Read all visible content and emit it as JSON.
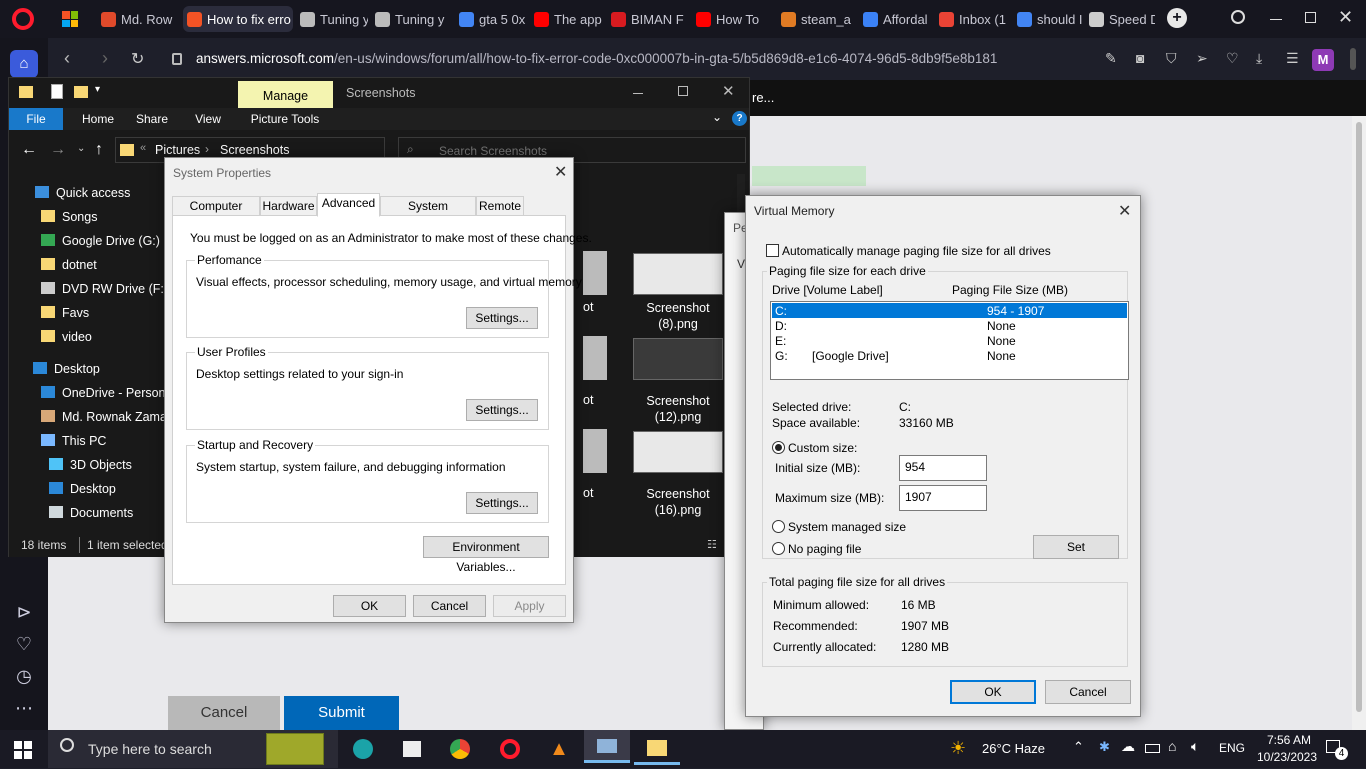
{
  "browser": {
    "tabs": [
      {
        "label": "Md. Row",
        "color": "#e04a2b"
      },
      {
        "label": "How to fix erro",
        "color": "#f35325"
      },
      {
        "label": "Tuning y",
        "color": "#bbbbbb"
      },
      {
        "label": "Tuning y",
        "color": "#bbbbbb"
      },
      {
        "label": "gta 5 0x",
        "color": "#4285f4"
      },
      {
        "label": "The app",
        "color": "#ff0000"
      },
      {
        "label": "BIMAN F",
        "color": "#d81b20"
      },
      {
        "label": "How To",
        "color": "#ff0000"
      },
      {
        "label": "steam_a",
        "color": "#e07b24"
      },
      {
        "label": "Affordal",
        "color": "#3b82f6"
      },
      {
        "label": "Inbox (1",
        "color": "#ea4335"
      },
      {
        "label": "should I",
        "color": "#4285f4"
      },
      {
        "label": "Speed D",
        "color": "#cccccc"
      }
    ],
    "url_domain": "answers.microsoft.com",
    "url_path": "/en-us/windows/forum/all/how-to-fix-error-code-0xc000007b-in-gta-5/b5d869d8-e1c6-4074-96d5-8db9f5e8b181",
    "profile_letter": "M",
    "page_fragment": "re...",
    "page_cancel": "Cancel",
    "page_submit": "Submit"
  },
  "explorer": {
    "manage_label": "Manage",
    "title": "Screenshots",
    "ribbon_tabs": [
      "File",
      "Home",
      "Share",
      "View",
      "Picture Tools"
    ],
    "breadcrumb": [
      "Pictures",
      "Screenshots"
    ],
    "search_placeholder": "Search Screenshots",
    "nav": [
      {
        "label": "Quick access",
        "icon": "star-icon"
      },
      {
        "label": "Songs",
        "icon": "folder-icon"
      },
      {
        "label": "Google Drive (G:)",
        "icon": "drive-icon"
      },
      {
        "label": "dotnet",
        "icon": "folder-icon"
      },
      {
        "label": "DVD RW Drive (F:)",
        "icon": "dvd-icon"
      },
      {
        "label": "Favs",
        "icon": "folder-icon"
      },
      {
        "label": "video",
        "icon": "folder-icon"
      },
      {
        "label": "Desktop",
        "icon": "desktop-icon"
      },
      {
        "label": "OneDrive - Persona",
        "icon": "cloud-icon"
      },
      {
        "label": "Md. Rownak Zamar",
        "icon": "user-icon"
      },
      {
        "label": "This PC",
        "icon": "pc-icon"
      },
      {
        "label": "3D Objects",
        "icon": "cube-icon"
      },
      {
        "label": "Desktop",
        "icon": "desktop-icon"
      },
      {
        "label": "Documents",
        "icon": "docs-icon"
      }
    ],
    "files": [
      {
        "name": "Screenshot\n(8).png"
      },
      {
        "name": "Screenshot\n(12).png"
      },
      {
        "name": "Screenshot\n(16).png"
      }
    ],
    "partial_labels": [
      "ot",
      "ot",
      "ot"
    ],
    "status_items": "18 items",
    "status_selected": "1 item selected"
  },
  "sysprops": {
    "title": "System Properties",
    "tabs": [
      "Computer Name",
      "Hardware",
      "Advanced",
      "System Protection",
      "Remote"
    ],
    "admin_note": "You must be logged on as an Administrator to make most of these changes.",
    "groups": [
      {
        "title": "Perfomance",
        "desc": "Visual effects, processor scheduling, memory usage, and virtual memory",
        "button": "Settings..."
      },
      {
        "title": "User Profiles",
        "desc": "Desktop settings related to your sign-in",
        "button": "Settings..."
      },
      {
        "title": "Startup and Recovery",
        "desc": "System startup, system failure, and debugging information",
        "button": "Settings..."
      }
    ],
    "env_button": "Environment Variables...",
    "ok": "OK",
    "cancel": "Cancel",
    "apply": "Apply"
  },
  "perf_behind": {
    "title_part": "Pe",
    "tab_part": "Vi"
  },
  "vm": {
    "title": "Virtual Memory",
    "auto_manage": "Automatically manage paging file size for all drives",
    "each_drive": "Paging file size for each drive",
    "col_drive": "Drive  [Volume Label]",
    "col_size": "Paging File Size (MB)",
    "drives": [
      {
        "drive": "C:",
        "label": "",
        "size": "954 - 1907"
      },
      {
        "drive": "D:",
        "label": "",
        "size": "None"
      },
      {
        "drive": "E:",
        "label": "",
        "size": "None"
      },
      {
        "drive": "G:",
        "label": "[Google Drive]",
        "size": "None"
      }
    ],
    "selected_drive_label": "Selected drive:",
    "selected_drive": "C:",
    "space_label": "Space available:",
    "space": "33160 MB",
    "custom_size": "Custom size:",
    "initial_label": "Initial size (MB):",
    "initial_value": "954",
    "max_label": "Maximum size (MB):",
    "max_value": "1907",
    "system_managed": "System managed size",
    "no_paging": "No paging file",
    "set": "Set",
    "total_title": "Total paging file size for all drives",
    "min_label": "Minimum allowed:",
    "min_value": "16 MB",
    "rec_label": "Recommended:",
    "rec_value": "1907 MB",
    "cur_label": "Currently allocated:",
    "cur_value": "1280 MB",
    "ok": "OK",
    "cancel": "Cancel"
  },
  "taskbar": {
    "search_placeholder": "Type here to search",
    "weather": "26°C  Haze",
    "lang": "ENG",
    "time": "7:56 AM",
    "date": "10/23/2023",
    "notif_count": "4"
  }
}
